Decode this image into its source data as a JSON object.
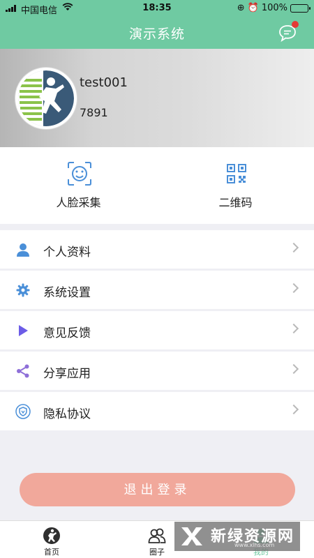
{
  "status_bar": {
    "carrier": "中国电信",
    "time": "18:35",
    "battery": "100%"
  },
  "navbar": {
    "title": "演示系统",
    "message_icon": "chat-bubble-icon",
    "has_notification": true
  },
  "profile": {
    "username": "test001",
    "user_id": "7891"
  },
  "quick_actions": [
    {
      "label": "人脸采集",
      "icon": "face-scan-icon"
    },
    {
      "label": "二维码",
      "icon": "qr-code-icon"
    }
  ],
  "menu": [
    {
      "label": "个人资料",
      "icon": "person-icon"
    },
    {
      "label": "系统设置",
      "icon": "gear-icon"
    },
    {
      "label": "意见反馈",
      "icon": "play-triangle-icon"
    },
    {
      "label": "分享应用",
      "icon": "share-icon"
    },
    {
      "label": "隐私协议",
      "icon": "shield-icon"
    }
  ],
  "logout_label": "退出登录",
  "tabs": [
    {
      "label": "首页",
      "icon": "runner-icon"
    },
    {
      "label": "圈子",
      "icon": "people-icon"
    },
    {
      "label": "我的",
      "icon": "user-icon",
      "active": true
    }
  ],
  "watermark": {
    "text": "新绿资源网",
    "url": "www.xlhs.com"
  },
  "colors": {
    "primary": "#6fcaa2",
    "logout": "#f1a89b",
    "notification_dot": "#e53935"
  }
}
